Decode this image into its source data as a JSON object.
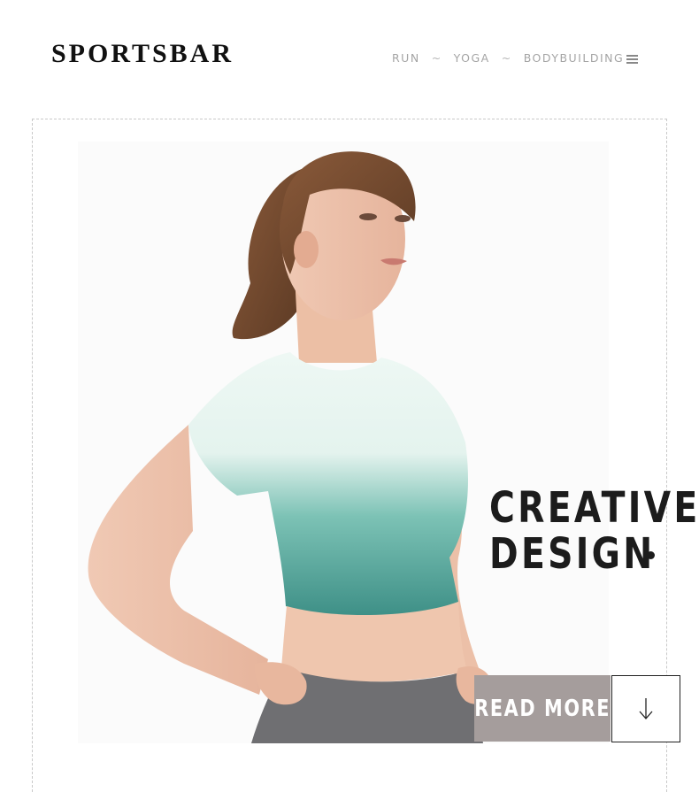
{
  "header": {
    "logo": "SPORTSBAR",
    "nav": [
      {
        "label": "RUN"
      },
      {
        "label": "YOGA"
      },
      {
        "label": "BODYBUILDING"
      }
    ],
    "separator": "~",
    "menu_icon": "hamburger-menu-icon"
  },
  "hero": {
    "image": "woman in gradient mint-to-teal crop top and grey leggings",
    "headline_line1": "CREATIVE",
    "headline_line2": "DESIGN",
    "read_more_label": "READ MORE",
    "down_icon": "arrow-down-icon"
  },
  "colors": {
    "read_more_bg": "#a59d9c",
    "headline": "#1c1c1c",
    "nav_text": "#a5a5a5",
    "shirt_top": "#e9f6f1",
    "shirt_bottom": "#3d8f86",
    "leggings": "#6f6f72"
  }
}
